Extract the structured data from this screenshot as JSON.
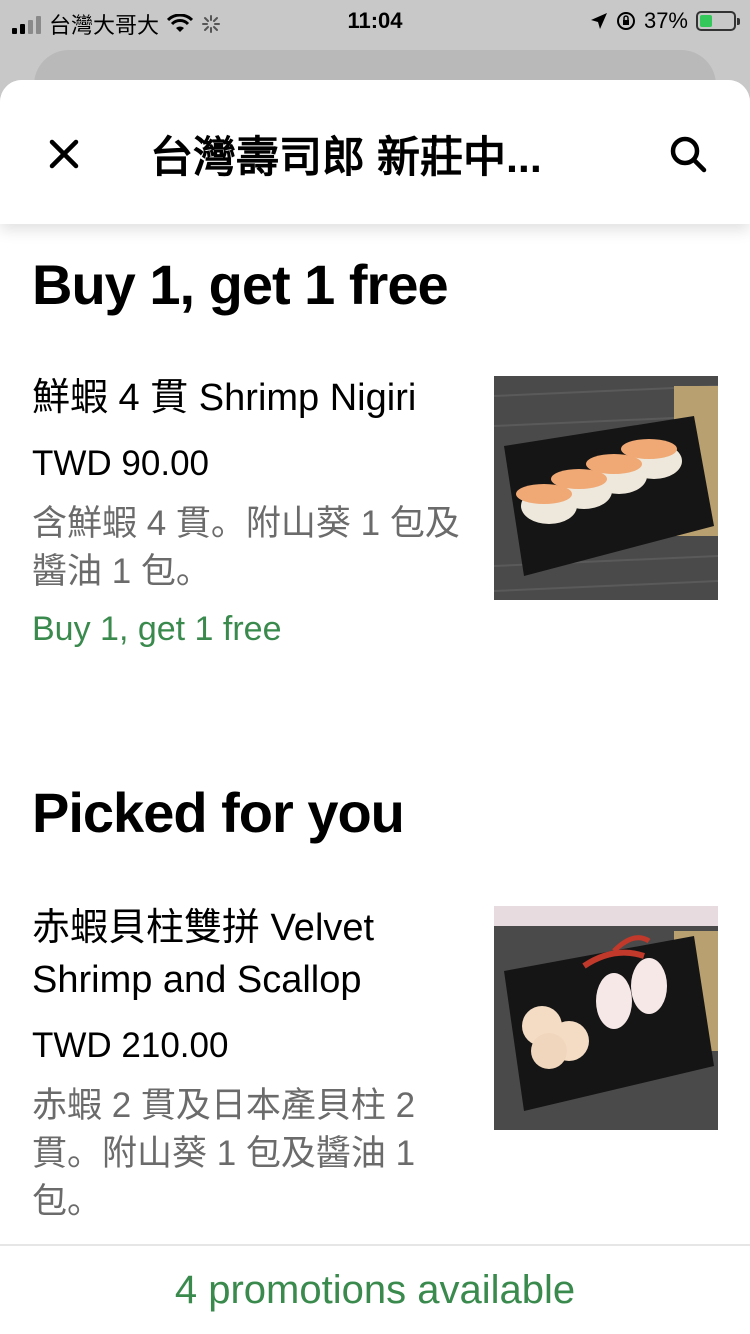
{
  "status_bar": {
    "carrier": "台灣大哥大",
    "time": "11:04",
    "battery": "37%",
    "battery_level": 0.37
  },
  "header": {
    "title": "台灣壽司郎 新莊中..."
  },
  "sections": [
    {
      "title": "Buy 1, get 1 free",
      "items": [
        {
          "name": "鮮蝦 4 貫 Shrimp Nigiri",
          "price": "TWD 90.00",
          "description": "含鮮蝦 4 貫。附山葵 1 包及醬油 1 包。",
          "promo": "Buy 1, get 1 free"
        }
      ]
    },
    {
      "title": "Picked for you",
      "items": [
        {
          "name": "赤蝦貝柱雙拼 Velvet Shrimp and Scallop",
          "price": "TWD 210.00",
          "description": "赤蝦 2 貫及日本產貝柱 2 貫。附山葵 1 包及醬油 1 包。"
        }
      ]
    }
  ],
  "footer": {
    "promotions_label": "4 promotions available"
  },
  "colors": {
    "promo_green": "#3a8a4e",
    "muted_text": "#6b6b6b"
  }
}
